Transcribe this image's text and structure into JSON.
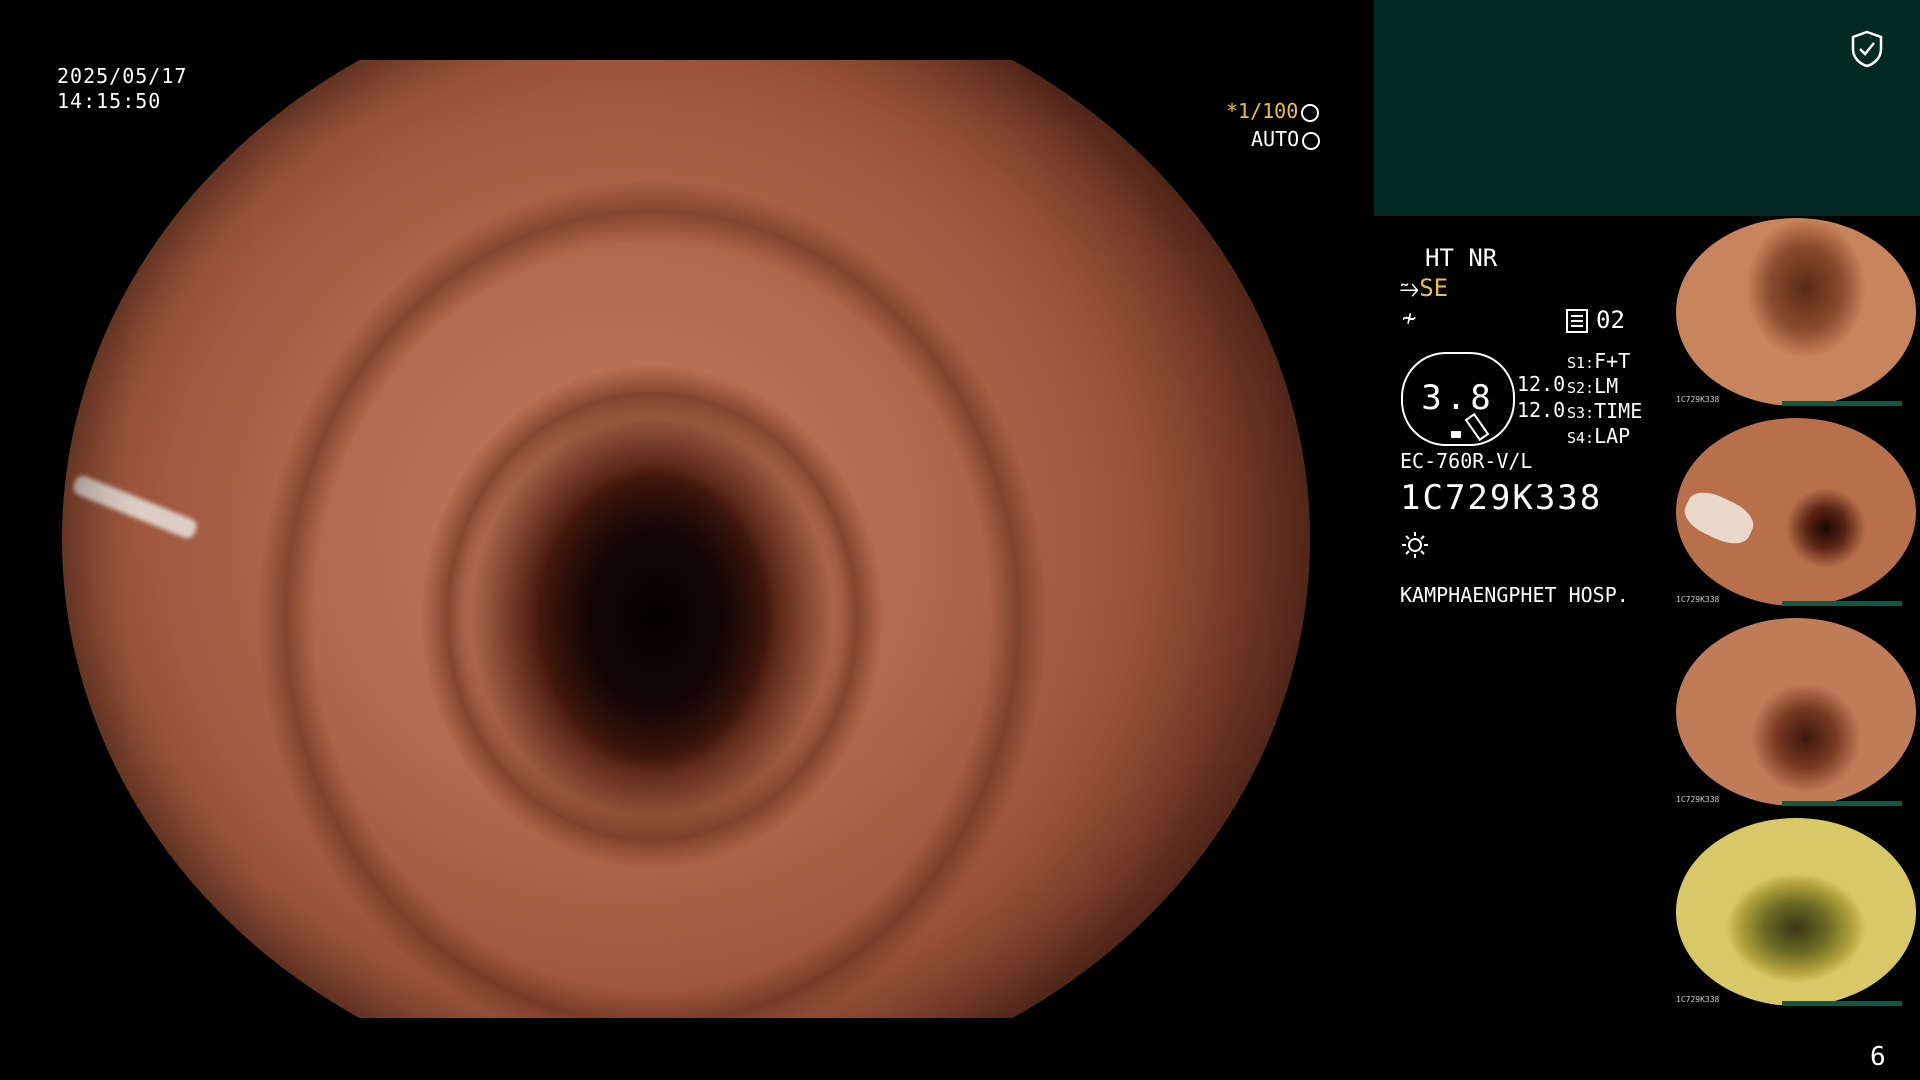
{
  "osd": {
    "date": "2025/05/17",
    "time": "14:15:50",
    "shutter": "*1/100",
    "auto": "AUTO"
  },
  "panel": {
    "ht_nr": "HT NR",
    "se": "SE",
    "mode": "02",
    "gauge_value": "3.8",
    "val_a": "12.0",
    "val_b": "12.0",
    "s1_key": "S1:",
    "s1_val": "F+T",
    "s2_key": "S2:",
    "s2_val": "LM",
    "s3_key": "S3:",
    "s3_val": "TIME",
    "s4_key": "S4:",
    "s4_val": "LAP",
    "scope_model": "EC-760R-V/L",
    "serial": "1C729K338",
    "hospital": "KAMPHAENGPHET HOSP."
  },
  "thumbnails": [
    {
      "caption": "1C729K338"
    },
    {
      "caption": "1C729K338"
    },
    {
      "caption": "1C729K338"
    },
    {
      "caption": "1C729K338"
    }
  ],
  "page_number": "6",
  "colors": {
    "accent_yellow": "#e7c04a",
    "panel_green": "#022a22"
  },
  "icons": [
    "shield-check-icon",
    "aperture-icon",
    "gear-ring-icon",
    "memory-icon",
    "light-source-icon"
  ]
}
